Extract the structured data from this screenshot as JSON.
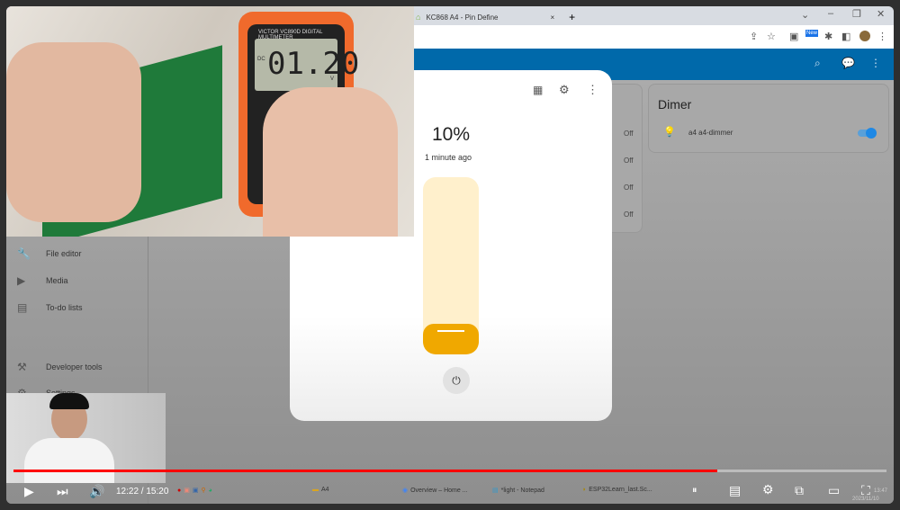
{
  "browser": {
    "tab_title": "KC868 A4 - Pin Define",
    "new_tab": "+",
    "close": "×",
    "badge_new": "New"
  },
  "sidebar": {
    "items": [
      {
        "label": "File editor",
        "icon": "wrench-icon"
      },
      {
        "label": "Media",
        "icon": "media-icon"
      },
      {
        "label": "To-do lists",
        "icon": "clipboard-icon"
      },
      {
        "label": "Developer tools",
        "icon": "hammer-icon"
      },
      {
        "label": "Settings",
        "icon": "gear-icon"
      }
    ]
  },
  "dialog": {
    "value": "10%",
    "updated": "1 minute ago",
    "brightness_percent": 10,
    "accent": "#f0a800",
    "track": "#fff0cc"
  },
  "left_card": {
    "states": [
      "Off",
      "Off",
      "Off",
      "Off"
    ]
  },
  "dimer_card": {
    "title": "Dimer",
    "entity": "a4 a4-dimmer",
    "toggle_on": true,
    "toggle_color": "#1e88e5"
  },
  "multimeter": {
    "brand": "VICTOR",
    "model": "VC890D",
    "label": "DIGITAL MULTIMETER",
    "reading": "01.20",
    "unit": "V",
    "mode": "DC"
  },
  "player": {
    "time": "12:22 / 15:20",
    "progress_fraction": 0.806,
    "progress_color": "#ff0000"
  },
  "taskbar": {
    "items": [
      "A4",
      "Overview – Home ...",
      "*light - Notepad",
      "ESP32Learn_last.Sc..."
    ],
    "clock": "13:47",
    "date": "2023/11/10",
    "lang": "ENG"
  },
  "header_color": "#0069aa"
}
